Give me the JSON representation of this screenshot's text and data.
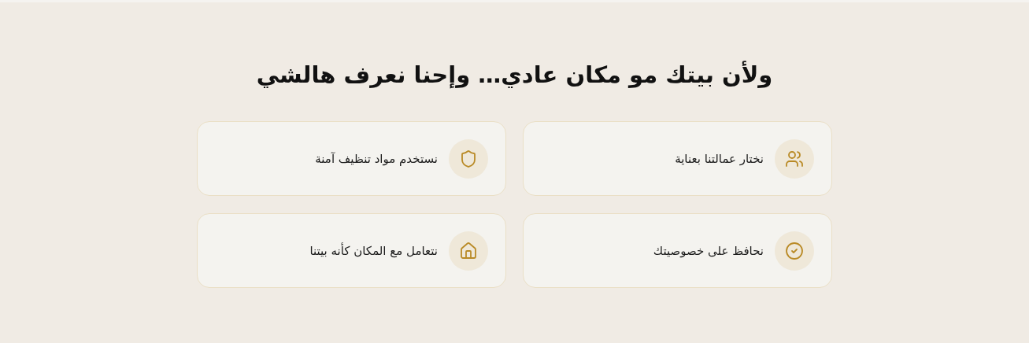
{
  "section": {
    "title": "ولأن بيتك مو مكان عادي… وإحنا نعرف هالشي",
    "features": [
      {
        "label": "نختار عمالتنا بعناية"
      },
      {
        "label": "نستخدم مواد تنظيف آمنة"
      },
      {
        "label": "نحافظ على خصوصيتك"
      },
      {
        "label": "نتعامل مع المكان كأنه بيتنا"
      }
    ]
  }
}
